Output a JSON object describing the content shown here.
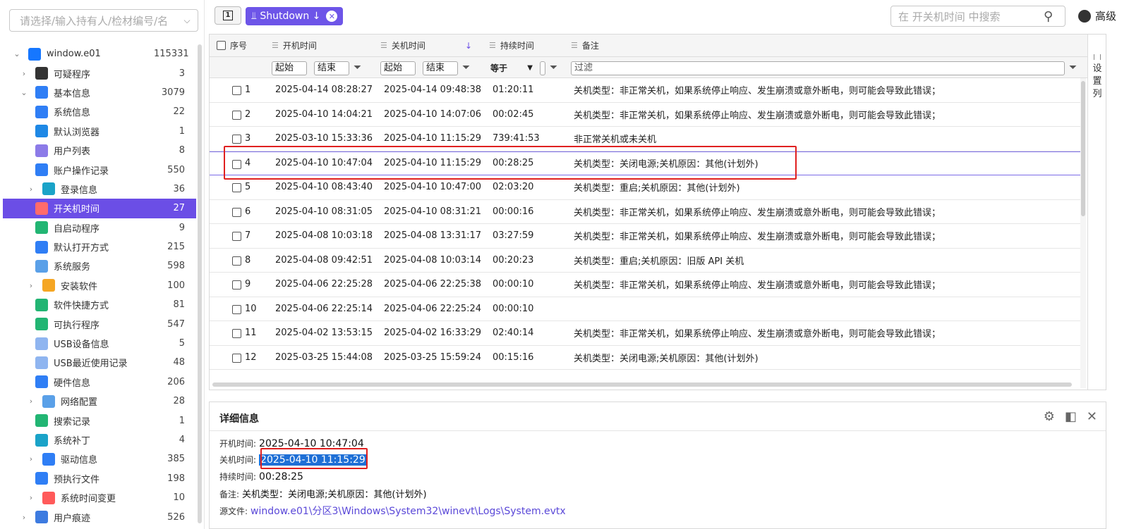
{
  "sidebar": {
    "search_placeholder": "请选择/输入持有人/检材编号/名",
    "tree": [
      {
        "label": "window.e01",
        "count": "115331",
        "level": 0,
        "arrow": "⌄",
        "icon": "windows-icon",
        "color": "#1677ff"
      },
      {
        "label": "可疑程序",
        "count": "3",
        "level": 1,
        "arrow": "›",
        "icon": "suspect-icon",
        "color": "#333333"
      },
      {
        "label": "基本信息",
        "count": "3079",
        "level": 1,
        "arrow": "⌄",
        "icon": "info-list-icon",
        "color": "#2f7ef5"
      },
      {
        "label": "系统信息",
        "count": "22",
        "level": 2,
        "arrow": "",
        "icon": "system-info-icon",
        "color": "#2f7ef5"
      },
      {
        "label": "默认浏览器",
        "count": "1",
        "level": 2,
        "arrow": "",
        "icon": "browser-icon",
        "color": "#1e88e5"
      },
      {
        "label": "用户列表",
        "count": "8",
        "level": 2,
        "arrow": "",
        "icon": "user-icon",
        "color": "#8c7be8"
      },
      {
        "label": "账户操作记录",
        "count": "550",
        "level": 2,
        "arrow": "",
        "icon": "account-log-icon",
        "color": "#2f7ef5"
      },
      {
        "label": "登录信息",
        "count": "36",
        "level": 2,
        "arrow": "›",
        "icon": "login-icon",
        "color": "#1aa3c8"
      },
      {
        "label": "开关机时间",
        "count": "27",
        "level": 2,
        "arrow": "",
        "icon": "power-icon",
        "color": "#ff5a5a",
        "active": true
      },
      {
        "label": "自启动程序",
        "count": "9",
        "level": 2,
        "arrow": "",
        "icon": "autostart-icon",
        "color": "#22b573"
      },
      {
        "label": "默认打开方式",
        "count": "215",
        "level": 2,
        "arrow": "",
        "icon": "open-with-icon",
        "color": "#2f7ef5"
      },
      {
        "label": "系统服务",
        "count": "598",
        "level": 2,
        "arrow": "",
        "icon": "service-icon",
        "color": "#5aa0e8"
      },
      {
        "label": "安装软件",
        "count": "100",
        "level": 2,
        "arrow": "›",
        "icon": "package-icon",
        "color": "#f5a623"
      },
      {
        "label": "软件快捷方式",
        "count": "81",
        "level": 2,
        "arrow": "",
        "icon": "shortcut-icon",
        "color": "#22b573"
      },
      {
        "label": "可执行程序",
        "count": "547",
        "level": 2,
        "arrow": "",
        "icon": "executable-icon",
        "color": "#22b573"
      },
      {
        "label": "USB设备信息",
        "count": "5",
        "level": 2,
        "arrow": "",
        "icon": "usb-icon",
        "color": "#8fb5f0"
      },
      {
        "label": "USB最近使用记录",
        "count": "48",
        "level": 2,
        "arrow": "",
        "icon": "usb-recent-icon",
        "color": "#8fb5f0"
      },
      {
        "label": "硬件信息",
        "count": "206",
        "level": 2,
        "arrow": "",
        "icon": "chip-icon",
        "color": "#2f7ef5"
      },
      {
        "label": "网络配置",
        "count": "28",
        "level": 2,
        "arrow": "›",
        "icon": "network-icon",
        "color": "#5aa0e8"
      },
      {
        "label": "搜索记录",
        "count": "1",
        "level": 2,
        "arrow": "",
        "icon": "search-log-icon",
        "color": "#22b573"
      },
      {
        "label": "系统补丁",
        "count": "4",
        "level": 2,
        "arrow": "",
        "icon": "patch-icon",
        "color": "#1aa3c8"
      },
      {
        "label": "驱动信息",
        "count": "385",
        "level": 2,
        "arrow": "›",
        "icon": "driver-icon",
        "color": "#2f7ef5"
      },
      {
        "label": "预执行文件",
        "count": "198",
        "level": 2,
        "arrow": "",
        "icon": "prefetch-icon",
        "color": "#2f7ef5"
      },
      {
        "label": "系统时间变更",
        "count": "10",
        "level": 2,
        "arrow": "›",
        "icon": "clock-icon",
        "color": "#ff5a5a"
      },
      {
        "label": "用户痕迹",
        "count": "526",
        "level": 1,
        "arrow": "›",
        "icon": "trace-icon",
        "color": "#3d7be0"
      }
    ]
  },
  "toolbar": {
    "panel_toggle_label": "1",
    "chip_label": "⫫ Shutdown ↓",
    "search_placeholder": "在 开关机时间 中搜索",
    "advanced_label": "高级"
  },
  "grid": {
    "headers": {
      "index": "序号",
      "start": "开机时间",
      "end": "关机时间",
      "duration": "持续时间",
      "remark": "备注"
    },
    "filters": {
      "start_from": "起始",
      "start_to": "结束",
      "end_from": "起始",
      "end_to": "结束",
      "duration_op": "等于",
      "remark": "过滤"
    },
    "rows": [
      {
        "index": "1",
        "start": "2025-04-14 08:28:27",
        "end": "2025-04-14 09:48:38",
        "duration": "01:20:11",
        "remark": "关机类型：非正常关机，如果系统停止响应、发生崩溃或意外断电，则可能会导致此错误；"
      },
      {
        "index": "2",
        "start": "2025-04-10 14:04:21",
        "end": "2025-04-10 14:07:06",
        "duration": "00:02:45",
        "remark": "关机类型：非正常关机，如果系统停止响应、发生崩溃或意外断电，则可能会导致此错误；"
      },
      {
        "index": "3",
        "start": "2025-03-10 15:33:36",
        "end": "2025-04-10 11:15:29",
        "duration": "739:41:53",
        "remark": "非正常关机或未关机"
      },
      {
        "index": "4",
        "start": "2025-04-10 10:47:04",
        "end": "2025-04-10 11:15:29",
        "duration": "00:28:25",
        "remark": "关机类型：关闭电源;关机原因：其他(计划外)"
      },
      {
        "index": "5",
        "start": "2025-04-10 08:43:40",
        "end": "2025-04-10 10:47:00",
        "duration": "02:03:20",
        "remark": "关机类型：重启;关机原因：其他(计划外)"
      },
      {
        "index": "6",
        "start": "2025-04-10 08:31:05",
        "end": "2025-04-10 08:31:21",
        "duration": "00:00:16",
        "remark": "关机类型：非正常关机，如果系统停止响应、发生崩溃或意外断电，则可能会导致此错误；"
      },
      {
        "index": "7",
        "start": "2025-04-08 10:03:18",
        "end": "2025-04-08 13:31:17",
        "duration": "03:27:59",
        "remark": "关机类型：非正常关机，如果系统停止响应、发生崩溃或意外断电，则可能会导致此错误；"
      },
      {
        "index": "8",
        "start": "2025-04-08 09:42:51",
        "end": "2025-04-08 10:03:14",
        "duration": "00:20:23",
        "remark": "关机类型：重启;关机原因：旧版 API 关机"
      },
      {
        "index": "9",
        "start": "2025-04-06 22:25:28",
        "end": "2025-04-06 22:25:38",
        "duration": "00:00:10",
        "remark": "关机类型：非正常关机，如果系统停止响应、发生崩溃或意外断电，则可能会导致此错误；"
      },
      {
        "index": "10",
        "start": "2025-04-06 22:25:14",
        "end": "2025-04-06 22:25:24",
        "duration": "00:00:10",
        "remark": ""
      },
      {
        "index": "11",
        "start": "2025-04-02 13:53:15",
        "end": "2025-04-02 16:33:29",
        "duration": "02:40:14",
        "remark": "关机类型：非正常关机，如果系统停止响应、发生崩溃或意外断电，则可能会导致此错误；"
      },
      {
        "index": "12",
        "start": "2025-03-25 15:44:08",
        "end": "2025-03-25 15:59:24",
        "duration": "00:15:16",
        "remark": "关机类型：关闭电源;关机原因：其他(计划外)"
      }
    ],
    "settings_column_label": "设置列"
  },
  "detail": {
    "title": "详细信息",
    "fields": {
      "start_label": "开机时间:",
      "start_value": "2025-04-10 10:47:04",
      "end_label": "关机时间:",
      "end_value": "2025-04-10 11:15:29",
      "duration_label": "持续时间:",
      "duration_value": "00:28:25",
      "remark_label": "备注:",
      "remark_value": "关机类型：关闭电源;关机原因：其他(计划外)",
      "source_label": "源文件:",
      "source_value": "window.e01\\分区3\\Windows\\System32\\winevt\\Logs\\System.evtx"
    }
  },
  "colors": {
    "accent": "#6b4ee6",
    "highlight_box": "#e02020",
    "selection": "#1f6fd6"
  }
}
